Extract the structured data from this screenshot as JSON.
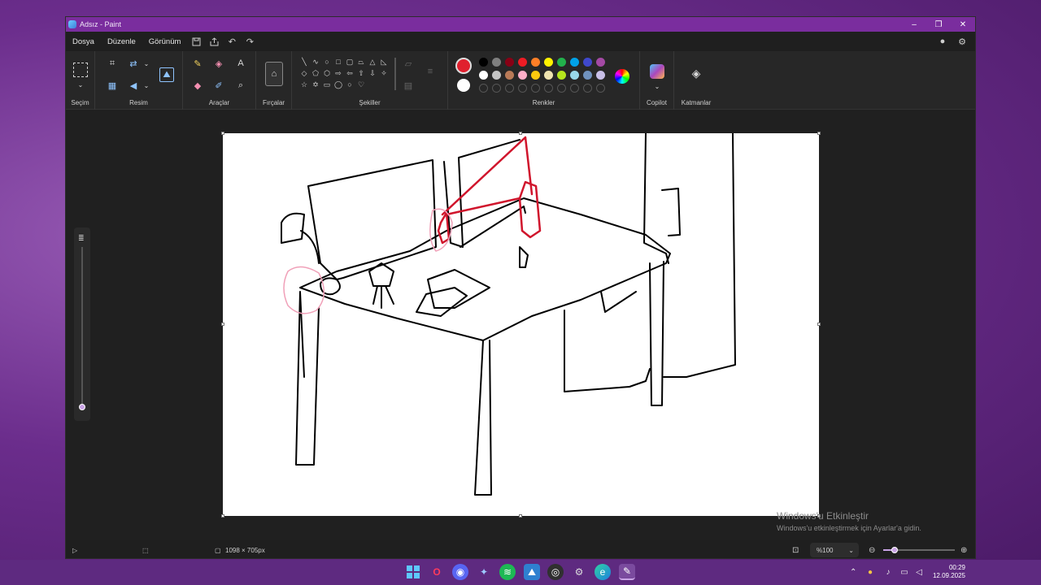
{
  "window": {
    "title": "Adsız - Paint",
    "minimize_glyph": "–",
    "maximize_glyph": "❐",
    "close_glyph": "✕"
  },
  "menu": {
    "file": "Dosya",
    "edit": "Düzenle",
    "view": "Görünüm"
  },
  "ribbon": {
    "selection_label": "Seçim",
    "image_label": "Resim",
    "tools_label": "Araçlar",
    "brushes_label": "Fırçalar",
    "shapes_label": "Şekiller",
    "colors_label": "Renkler",
    "copilot_label": "Copilot",
    "layers_label": "Katmanlar",
    "text_tool_glyph": "A"
  },
  "colors": {
    "primary": "#e0202e",
    "secondary": "#ffffff",
    "palette_row1": [
      "#000000",
      "#7f7f7f",
      "#880015",
      "#ed1c24",
      "#ff7f27",
      "#fff200",
      "#22b14c",
      "#00a2e8",
      "#3f48cc",
      "#a349a4"
    ],
    "palette_row2": [
      "#ffffff",
      "#c3c3c3",
      "#b97a57",
      "#ffaec9",
      "#ffc90e",
      "#efe4b0",
      "#b5e61d",
      "#99d9ea",
      "#7092be",
      "#c8bfe7"
    ],
    "accent": "#7a2d9e"
  },
  "status": {
    "canvas_size": "1098 × 705px",
    "zoom": "%100"
  },
  "watermark": {
    "line1": "Windows'u Etkinleştir",
    "line2": "Windows'u etkinleştirmek için Ayarlar'a gidin."
  },
  "clock": {
    "time": "00:29",
    "date": "12.09.2025"
  },
  "taskbar_icons": [
    "start-icon",
    "opera-icon",
    "discord-icon",
    "bluetooth-app-icon",
    "spotify-icon",
    "photos-icon",
    "obs-icon",
    "settings-icon",
    "edge-icon",
    "paint-icon"
  ]
}
